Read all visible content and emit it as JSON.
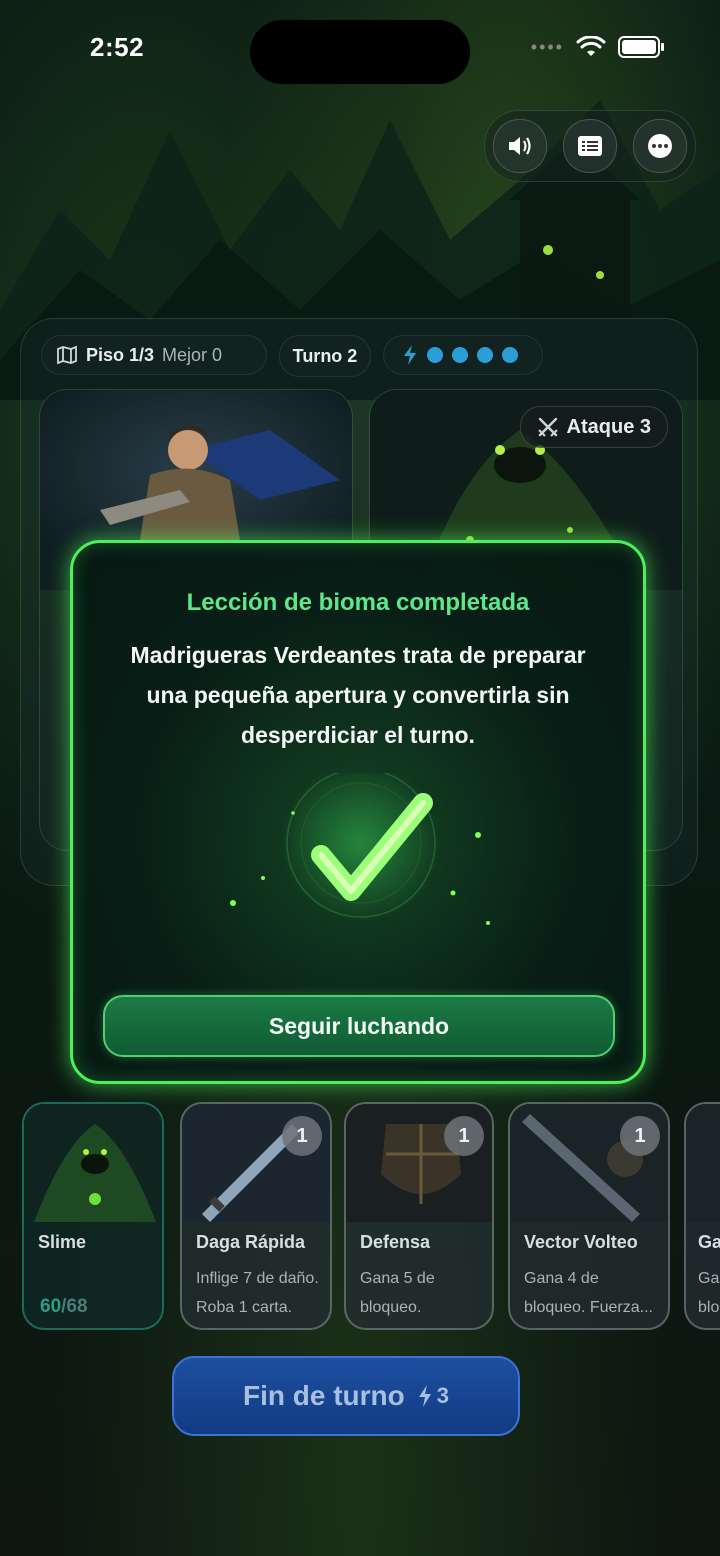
{
  "status_bar": {
    "time": "2:52"
  },
  "top_controls": {
    "icons": [
      "speaker-icon",
      "log-icon",
      "more-icon"
    ]
  },
  "battle": {
    "floor_label": "Piso 1/3",
    "best_label": "Mejor 0",
    "turn_label": "Turno 2",
    "energy_dots": 4,
    "enemy_attack_label": "Ataque 3"
  },
  "modal": {
    "title": "Lección de bioma completada",
    "body": "Madrigueras Verdeantes trata de preparar una pequeña apertura y convertirla sin desperdiciar el turno.",
    "button_label": "Seguir luchando"
  },
  "hand": {
    "enemy_card": {
      "name": "Slime",
      "hp": "60",
      "hp_max": "/68"
    },
    "cards": [
      {
        "name": "Daga Rápida",
        "desc_line1": "Inflige 7 de daño.",
        "desc_line2": "Roba 1 carta.",
        "cost": "1"
      },
      {
        "name": "Defensa",
        "desc_line1": "Gana 5 de",
        "desc_line2": "bloqueo.",
        "cost": "1"
      },
      {
        "name": "Vector Volteo",
        "desc_line1": "Gana 4 de",
        "desc_line2": "bloqueo. Fuerza...",
        "cost": "1"
      },
      {
        "name": "Ga",
        "desc_line1": "Ga",
        "desc_line2": "blo",
        "cost": ""
      }
    ]
  },
  "end_turn": {
    "label": "Fin de turno",
    "cost": "3"
  },
  "colors": {
    "accent_green": "#4cf05c",
    "title_green": "#5ee68a",
    "energy_blue": "#2c9ed6",
    "end_turn_blue": "#1d4fa0"
  }
}
